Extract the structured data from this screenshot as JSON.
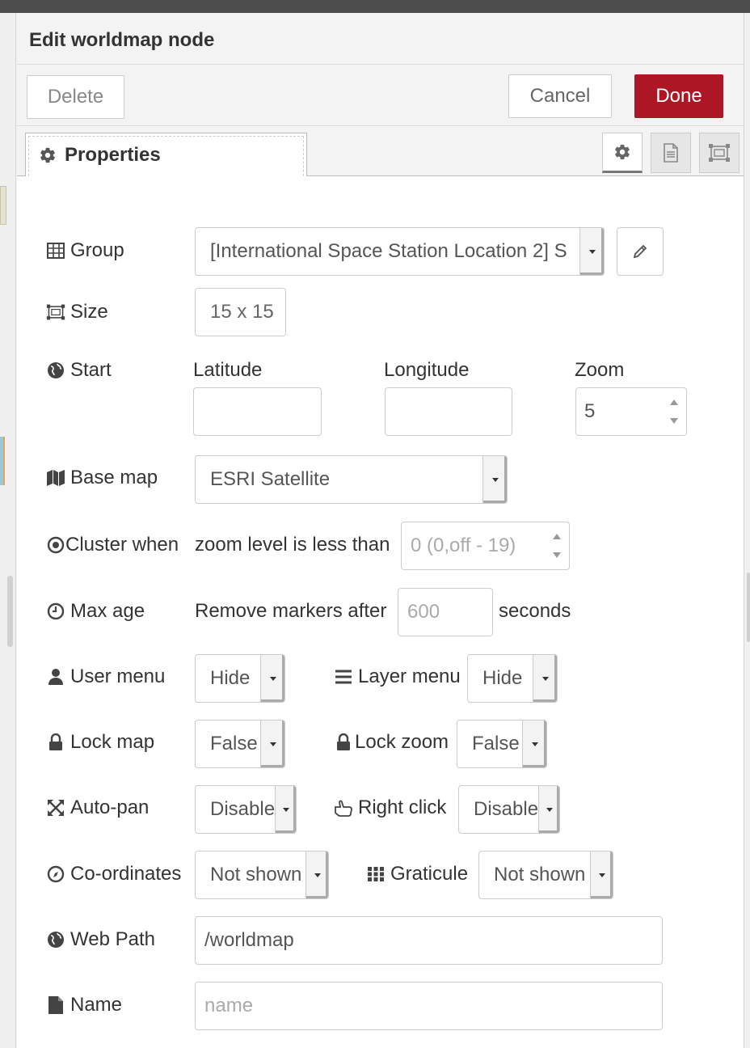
{
  "dialog": {
    "title": "Edit worldmap node",
    "buttons": {
      "delete": "Delete",
      "cancel": "Cancel",
      "done": "Done"
    },
    "tabs": {
      "properties": "Properties"
    }
  },
  "form": {
    "group": {
      "label": "Group",
      "value": "[International Space Station Location 2] S"
    },
    "size": {
      "label": "Size",
      "value": "15 x 15"
    },
    "start": {
      "label": "Start",
      "latitude_label": "Latitude",
      "longitude_label": "Longitude",
      "zoom_label": "Zoom",
      "latitude": "",
      "longitude": "",
      "zoom": "5"
    },
    "basemap": {
      "label": "Base map",
      "value": "ESRI Satellite"
    },
    "cluster": {
      "label": "Cluster when",
      "text": "zoom level is less than",
      "placeholder": "0 (0,off - 19)"
    },
    "maxage": {
      "label": "Max age",
      "text": "Remove markers after",
      "placeholder": "600",
      "suffix": "seconds"
    },
    "usermenu": {
      "label": "User menu",
      "value": "Hide"
    },
    "layermenu": {
      "label": "Layer menu",
      "value": "Hide"
    },
    "lockmap": {
      "label": "Lock map",
      "value": "False"
    },
    "lockzoom": {
      "label": "Lock zoom",
      "value": "False"
    },
    "autopan": {
      "label": "Auto-pan",
      "value": "Disable"
    },
    "rightclick": {
      "label": "Right click",
      "value": "Disable"
    },
    "coordinates": {
      "label": "Co-ordinates",
      "value": "Not shown"
    },
    "graticule": {
      "label": "Graticule",
      "value": "Not shown"
    },
    "webpath": {
      "label": "Web Path",
      "value": "/worldmap"
    },
    "name": {
      "label": "Name",
      "placeholder": "name"
    }
  },
  "colors": {
    "accent": "#ad1625",
    "border": "#cccccc",
    "text": "#333333"
  },
  "icons": [
    "cog-icon",
    "file-text-icon",
    "resize-icon",
    "table-icon",
    "globe-icon",
    "map-icon",
    "dot-circle-icon",
    "clock-icon",
    "user-icon",
    "bars-icon",
    "lock-icon",
    "arrows-icon",
    "hand-pointer-icon",
    "compass-icon",
    "th-icon",
    "file-icon",
    "pencil-icon"
  ]
}
